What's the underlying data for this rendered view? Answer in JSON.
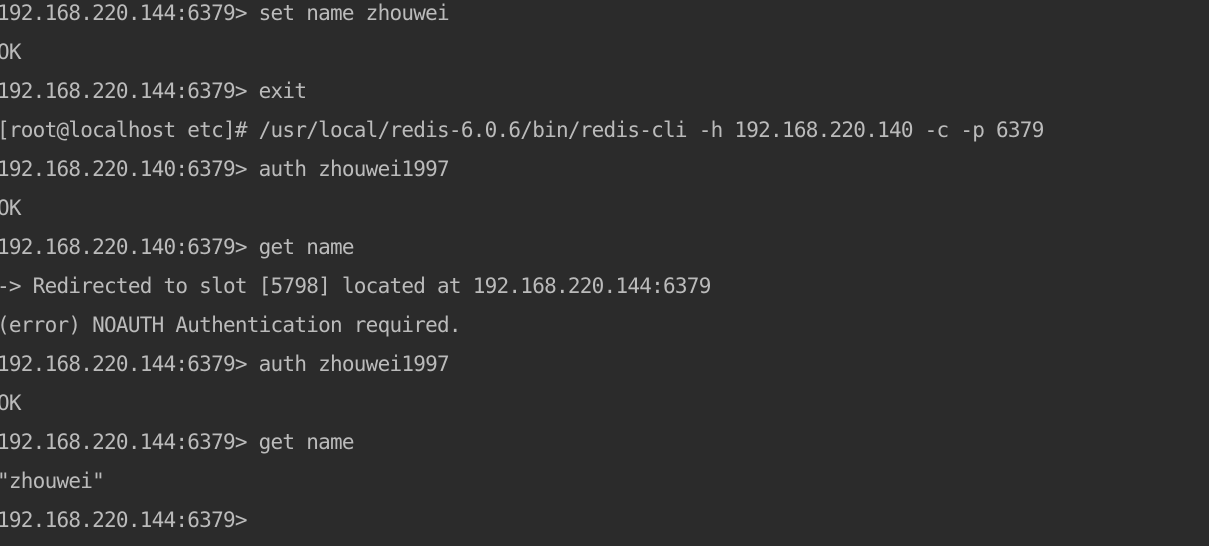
{
  "terminal": {
    "lines": [
      "192.168.220.144:6379> set name zhouwei",
      "OK",
      "192.168.220.144:6379> exit",
      "[root@localhost etc]# /usr/local/redis-6.0.6/bin/redis-cli -h 192.168.220.140 -c -p 6379",
      "192.168.220.140:6379> auth zhouwei1997",
      "OK",
      "192.168.220.140:6379> get name",
      "-> Redirected to slot [5798] located at 192.168.220.144:6379",
      "(error) NOAUTH Authentication required.",
      "192.168.220.144:6379> auth zhouwei1997",
      "OK",
      "192.168.220.144:6379> get name",
      "\"zhouwei\"",
      "192.168.220.144:6379>"
    ],
    "colors": {
      "background": "#2b2b2b",
      "text": "#bbbbbb"
    }
  }
}
